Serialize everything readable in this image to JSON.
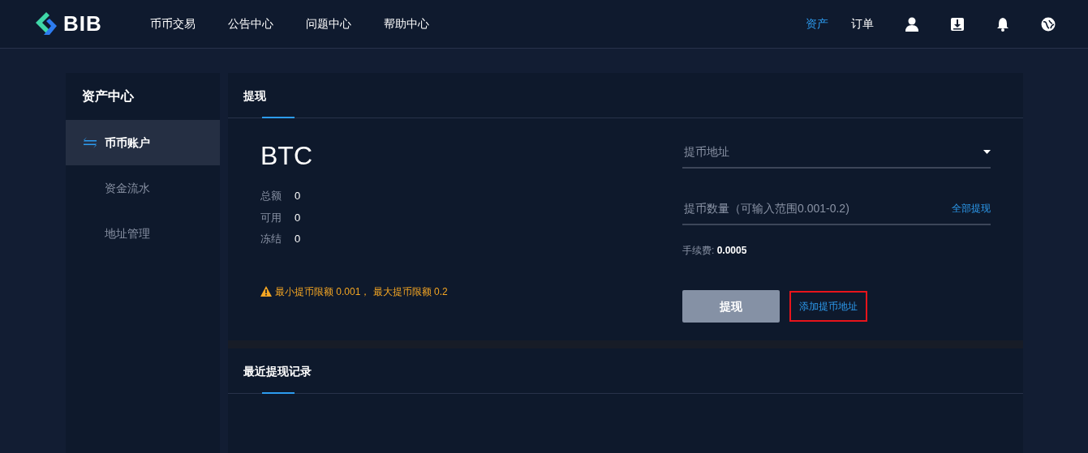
{
  "header": {
    "logo": "BIB",
    "nav": [
      {
        "label": "币币交易",
        "selected": false
      },
      {
        "label": "公告中心",
        "selected": false
      },
      {
        "label": "问题中心",
        "selected": false
      },
      {
        "label": "帮助中心",
        "selected": false
      }
    ],
    "right_nav": [
      {
        "label": "资产",
        "selected": true
      },
      {
        "label": "订单",
        "selected": false
      }
    ],
    "icons": [
      {
        "kind": "user"
      },
      {
        "kind": "download"
      },
      {
        "kind": "bell"
      },
      {
        "kind": "globe"
      }
    ]
  },
  "sidebar": {
    "title": "资产中心",
    "items": [
      {
        "label": "币币账户",
        "selected": true
      },
      {
        "label": "资金流水",
        "selected": false
      },
      {
        "label": "地址管理",
        "selected": false
      }
    ]
  },
  "withdraw": {
    "tab": "提现",
    "coin": "BTC",
    "balances": [
      {
        "label": "总额",
        "value": "0"
      },
      {
        "label": "可用",
        "value": "0"
      },
      {
        "label": "冻结",
        "value": "0"
      }
    ],
    "warning": "最小提币限额 0.001， 最大提币限额 0.2",
    "address": {
      "placeholder": "提币地址"
    },
    "amount": {
      "placeholder": "提币数量（可输入范围0.001-0.2)",
      "all_link": "全部提现"
    },
    "fee_label": "手续费:",
    "fee_value": "0.0005",
    "submit": {
      "label": "提现",
      "disabled": true
    },
    "add_address": {
      "label": "添加提币地址",
      "outlined": true
    }
  },
  "records": {
    "tab": "最近提现记录"
  }
}
